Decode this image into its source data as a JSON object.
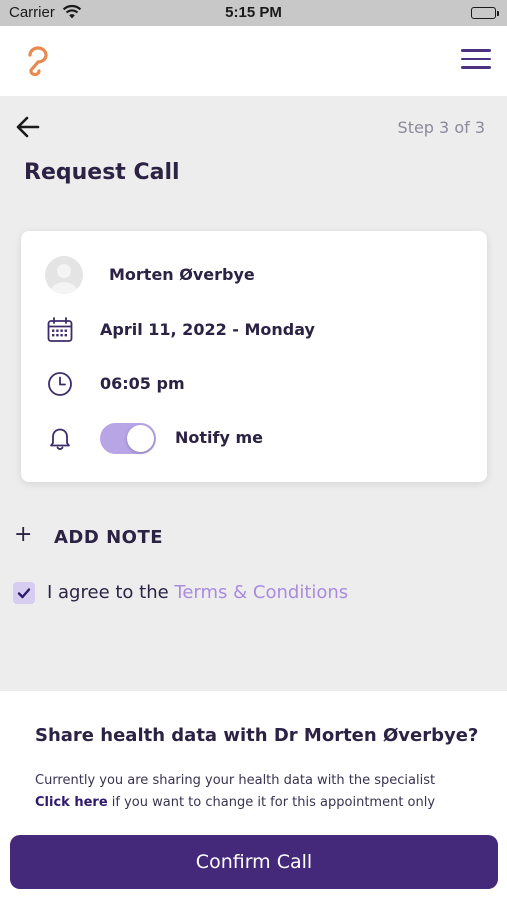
{
  "status_bar": {
    "carrier": "Carrier",
    "time": "5:15 PM"
  },
  "header": {
    "logo_icon": "brand-logo-icon",
    "menu_icon": "hamburger-menu-icon"
  },
  "nav": {
    "back_icon": "arrow-left-icon",
    "step": "Step 3 of 3"
  },
  "page": {
    "title": "Request Call"
  },
  "appointment": {
    "doctor_name": "Morten Øverbye",
    "date": "April 11, 2022 - Monday",
    "time": "06:05 pm",
    "notify_label": "Notify me",
    "notify_enabled": true,
    "icons": [
      "avatar-placeholder",
      "calendar-icon",
      "clock-icon",
      "bell-icon"
    ]
  },
  "note": {
    "plus": "+",
    "label": "ADD NOTE"
  },
  "agreement": {
    "checked": true,
    "prefix": "I agree to the ",
    "link": "Terms & Conditions"
  },
  "share": {
    "title": "Share health data with Dr Morten Øverbye?",
    "description": "Currently you are sharing your health data with the specialist",
    "click_here": "Click here",
    "description_suffix": " if you want to change it for this appointment only"
  },
  "actions": {
    "confirm_label": "Confirm Call"
  },
  "colors": {
    "primary": "#44287a",
    "accent": "#a98be0",
    "toggle_on": "#b7a5e6",
    "logo_orange": "#e8894f",
    "background": "#ededed"
  }
}
